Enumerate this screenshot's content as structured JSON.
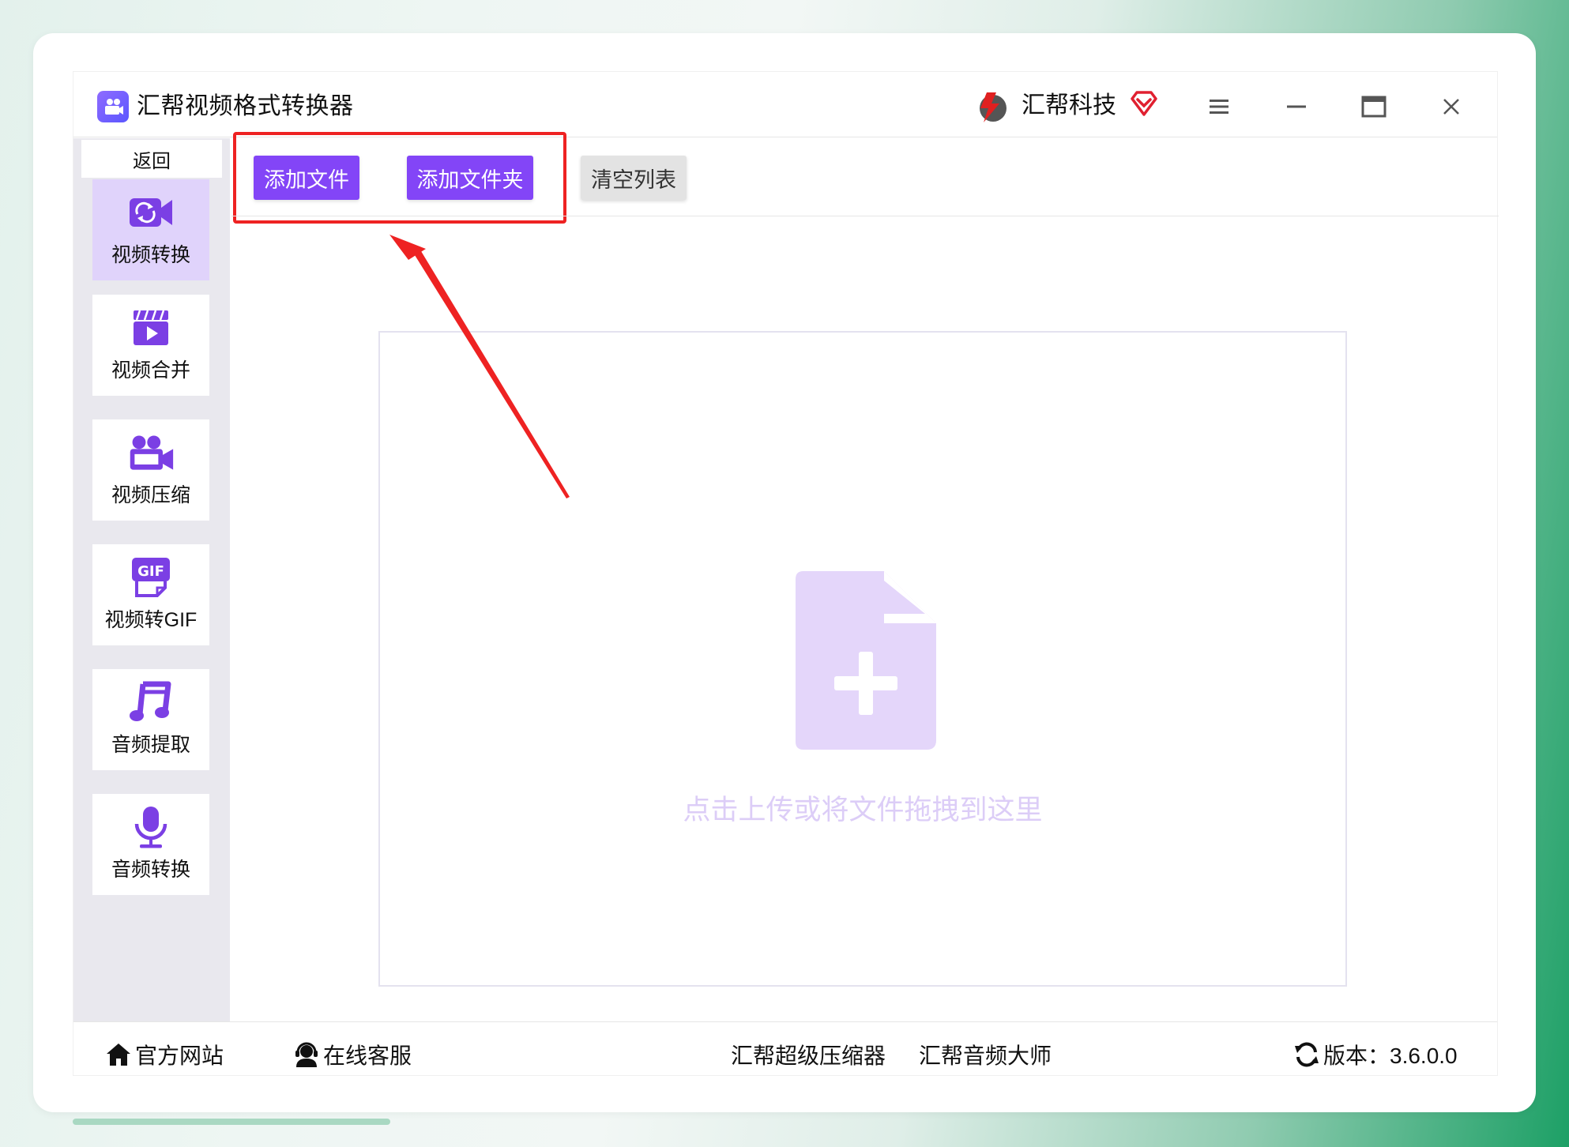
{
  "app": {
    "title": "汇帮视频格式转换器",
    "brand": "汇帮科技"
  },
  "sidebar": {
    "back_label": "返回",
    "items": [
      {
        "label": "视频转换",
        "icon": "video-convert-icon",
        "active": true
      },
      {
        "label": "视频合并",
        "icon": "video-merge-icon",
        "active": false
      },
      {
        "label": "视频压缩",
        "icon": "video-compress-icon",
        "active": false
      },
      {
        "label": "视频转GIF",
        "icon": "gif-icon",
        "active": false
      },
      {
        "label": "音频提取",
        "icon": "music-note-icon",
        "active": false
      },
      {
        "label": "音频转换",
        "icon": "microphone-icon",
        "active": false
      }
    ]
  },
  "toolbar": {
    "add_file_label": "添加文件",
    "add_folder_label": "添加文件夹",
    "clear_list_label": "清空列表"
  },
  "dropzone": {
    "hint": "点击上传或将文件拖拽到这里",
    "icon": "file-add-icon"
  },
  "footer": {
    "website_label": "官方网站",
    "support_label": "在线客服",
    "compressor_label": "汇帮超级压缩器",
    "audio_master_label": "汇帮音频大师",
    "version_label": "版本：3.6.0.0"
  },
  "colors": {
    "accent": "#8345f7",
    "sidebar_bg": "#e9e8ee",
    "active_item_bg": "#e0d3fb",
    "highlight": "#ee2222",
    "drop_hint": "#dccdf7"
  }
}
